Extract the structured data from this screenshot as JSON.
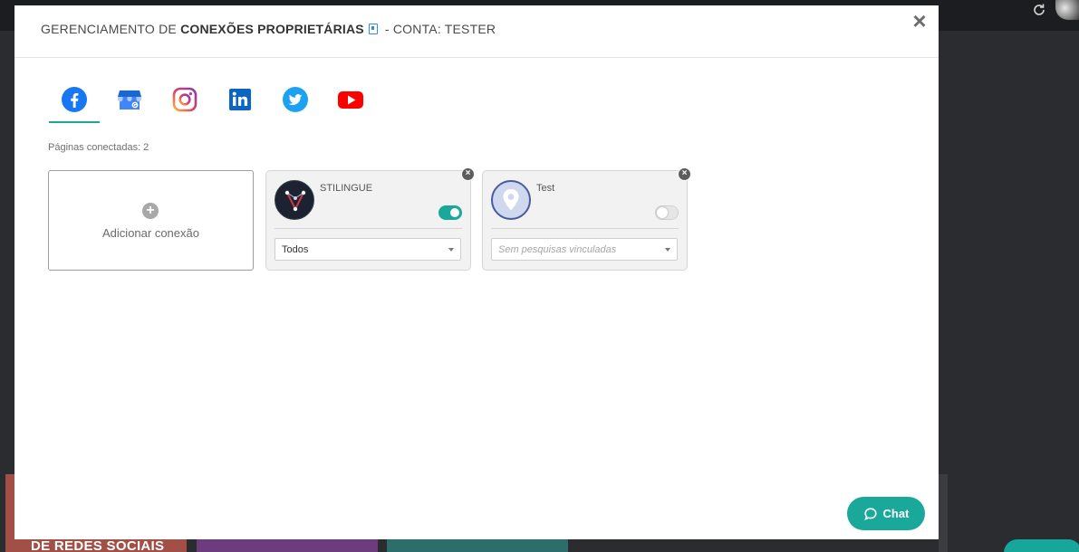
{
  "background": {
    "tile_text": "DE REDES SOCIAIS"
  },
  "modal": {
    "title_prefix": "GERENCIAMENTO DE",
    "title_bold": "CONEXÕES PROPRIETÁRIAS",
    "title_suffix": "- CONTA: TESTER",
    "close_label": "×"
  },
  "tabs": [
    {
      "name": "facebook",
      "icon": "facebook-icon",
      "active": true
    },
    {
      "name": "google-my-business",
      "icon": "google-my-business-icon",
      "active": false
    },
    {
      "name": "instagram",
      "icon": "instagram-icon",
      "active": false
    },
    {
      "name": "linkedin",
      "icon": "linkedin-icon",
      "active": false
    },
    {
      "name": "twitter",
      "icon": "twitter-icon",
      "active": false
    },
    {
      "name": "youtube",
      "icon": "youtube-icon",
      "active": false
    }
  ],
  "connected_count": "Páginas conectadas: 2",
  "add_connection": {
    "label": "Adicionar conexão",
    "icon": "plus-icon"
  },
  "connections": [
    {
      "name": "STILINGUE",
      "enabled": true,
      "select_value": "Todos",
      "select_placeholder": false
    },
    {
      "name": "Test",
      "enabled": false,
      "select_value": "Sem pesquisas vinculadas",
      "select_placeholder": true
    }
  ],
  "chat": {
    "label": "Chat",
    "icon": "chat-bubble-icon"
  },
  "colors": {
    "accent": "#1aa89b",
    "facebook": "#1877f2",
    "linkedin": "#0a66c2",
    "twitter": "#1da1f2",
    "youtube": "#ff0000"
  }
}
